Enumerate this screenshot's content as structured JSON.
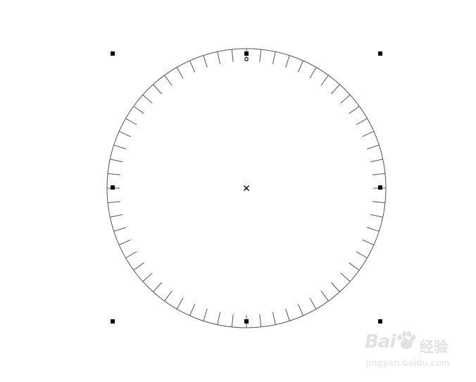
{
  "canvas": {
    "background": "#ffffff",
    "stroke_color": "#555555",
    "handle_color": "#000000"
  },
  "dial": {
    "tick_count": 60
  },
  "watermark": {
    "brand": "Bai  u",
    "tag": "经验",
    "url": "jingyan.baidu.com",
    "icon": "paw-icon",
    "color": "#c9c9c9"
  }
}
